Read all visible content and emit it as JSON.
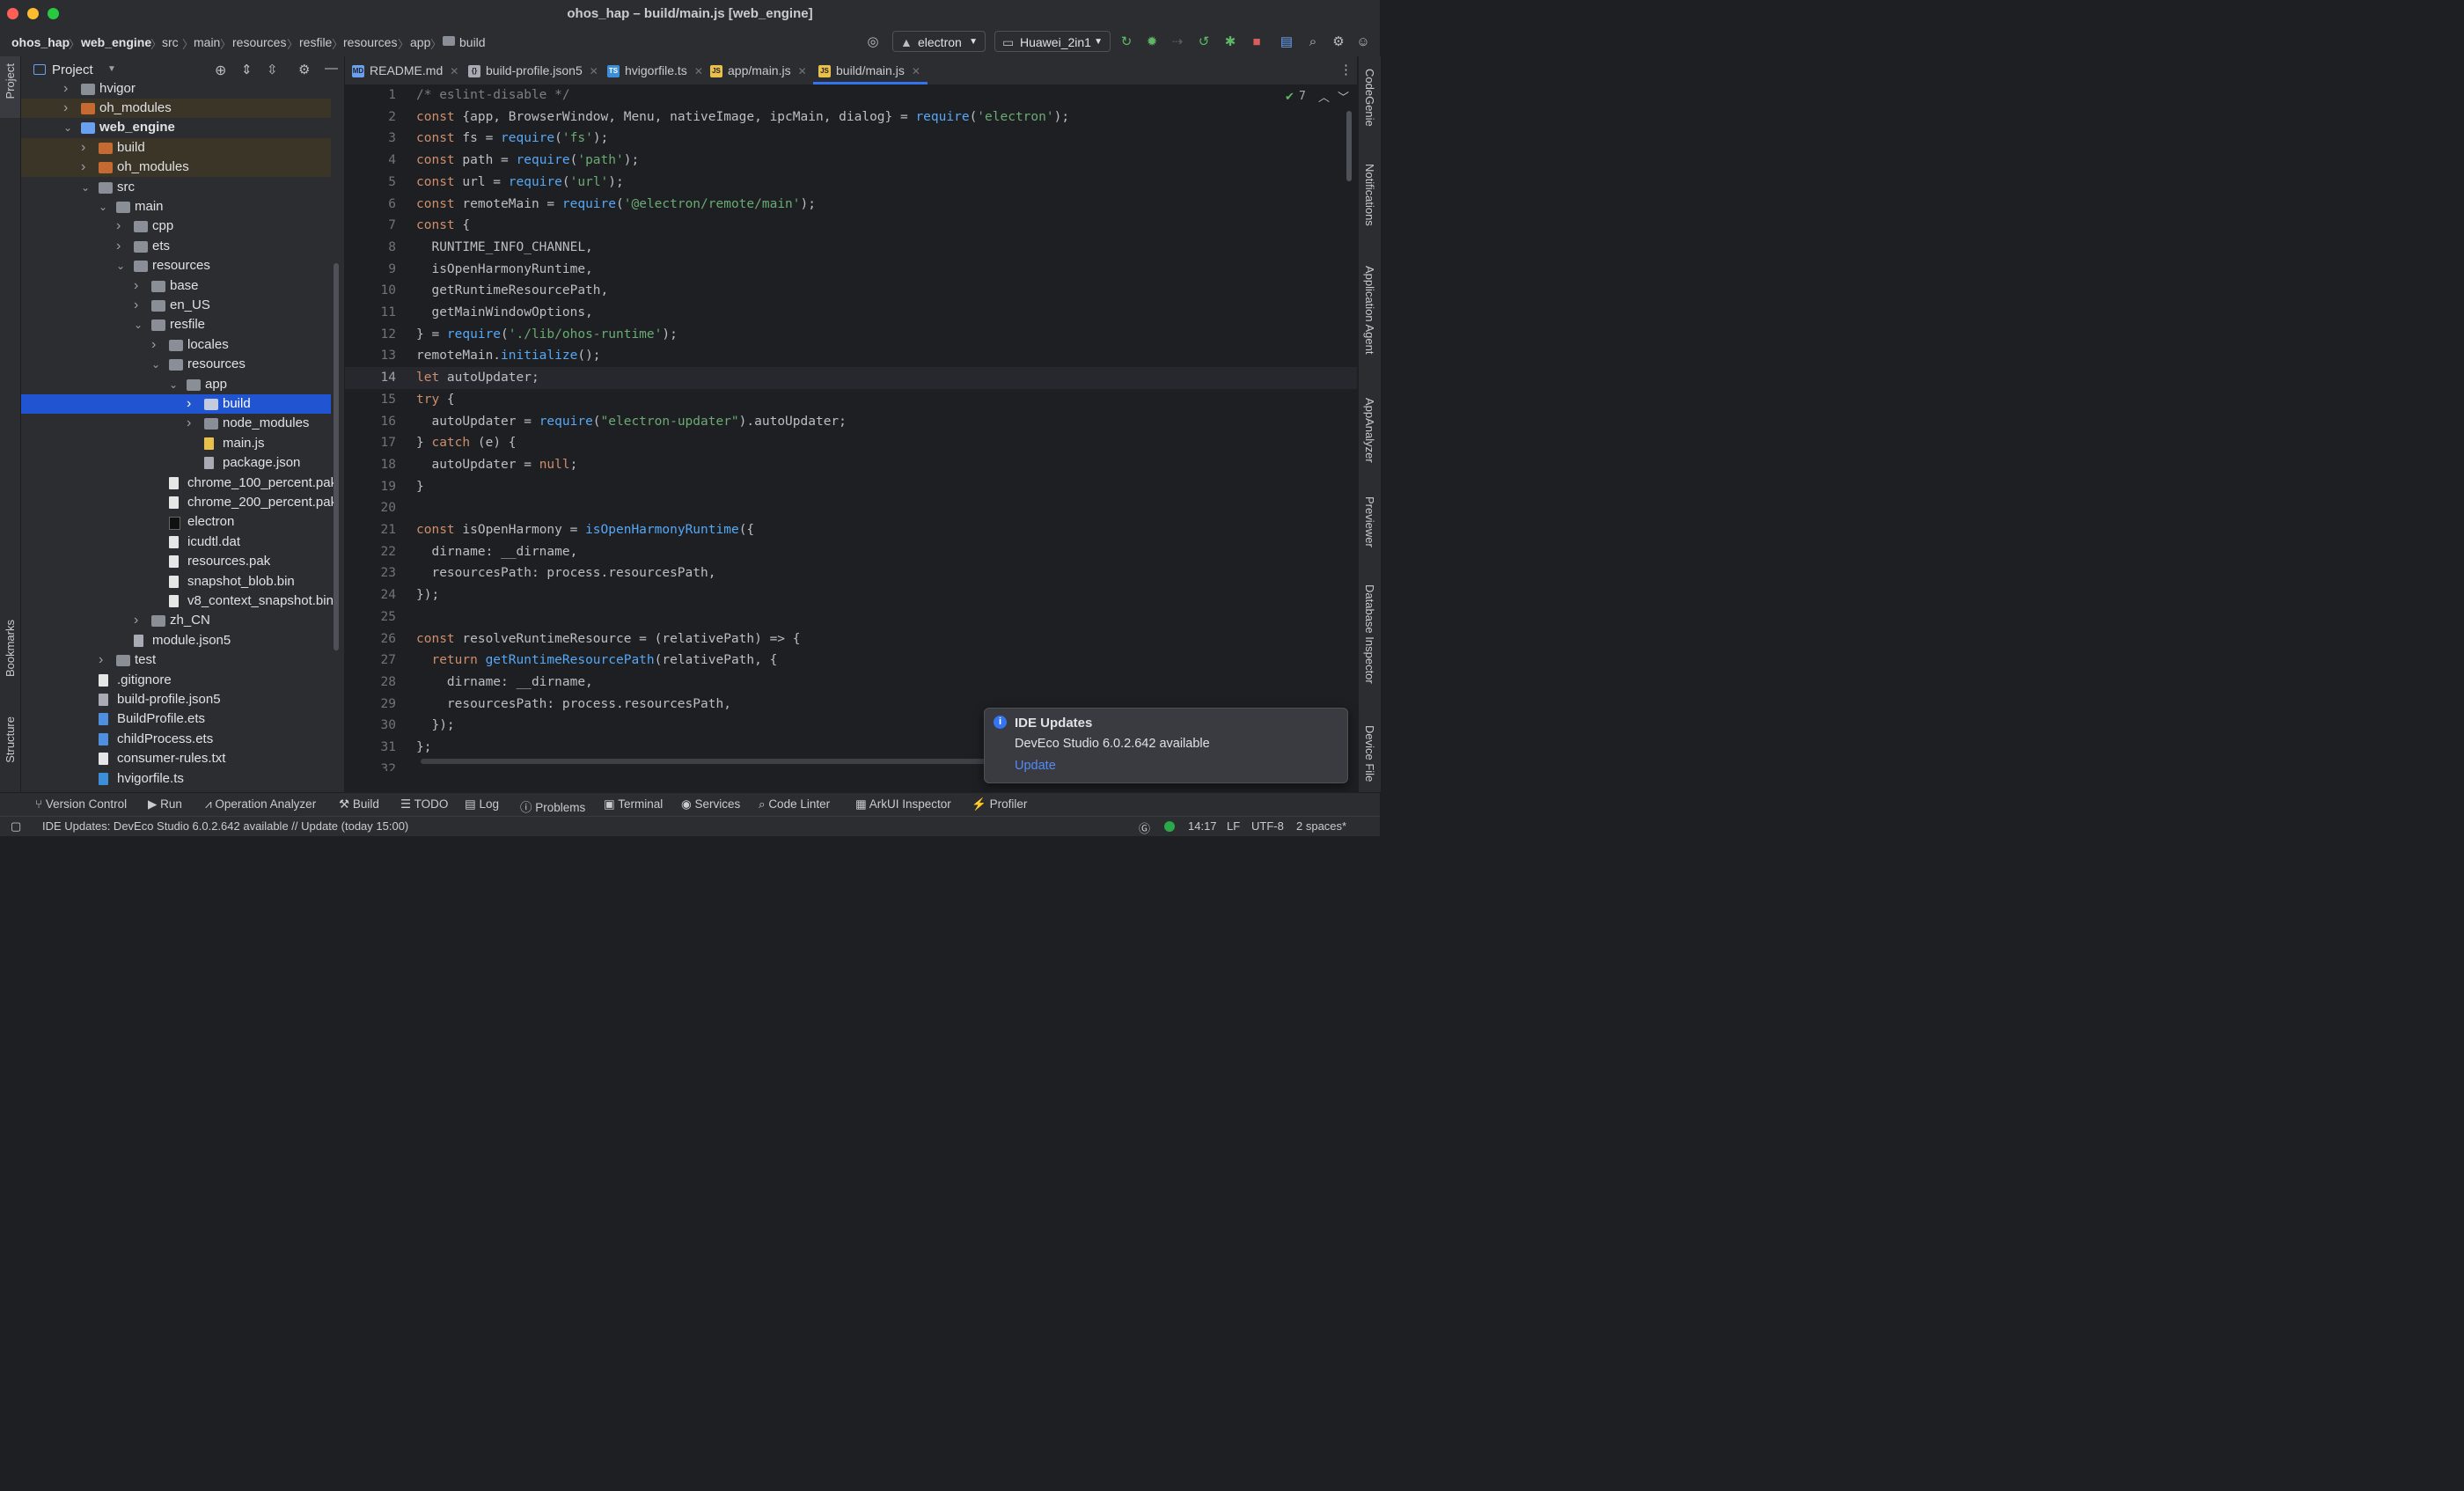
{
  "window": {
    "title": "ohos_hap – build/main.js [web_engine]"
  },
  "breadcrumbs": [
    "ohos_hap",
    "web_engine",
    "src",
    "main",
    "resources",
    "resfile",
    "resources",
    "app",
    "build"
  ],
  "toolbar": {
    "run_config": "electron",
    "device": "Huawei_2in1"
  },
  "project_panel": {
    "title": "Project"
  },
  "tree": [
    {
      "label": "hvigor",
      "depth": 1,
      "kind": "folder",
      "arrow": "right"
    },
    {
      "label": "oh_modules",
      "depth": 1,
      "kind": "folder-orange",
      "arrow": "right",
      "excluded": true
    },
    {
      "label": "web_engine",
      "depth": 1,
      "kind": "folder-module",
      "arrow": "down",
      "bold": true
    },
    {
      "label": "build",
      "depth": 2,
      "kind": "folder-orange",
      "arrow": "right",
      "excluded": true
    },
    {
      "label": "oh_modules",
      "depth": 2,
      "kind": "folder-orange",
      "arrow": "right",
      "excluded": true
    },
    {
      "label": "src",
      "depth": 2,
      "kind": "folder",
      "arrow": "down"
    },
    {
      "label": "main",
      "depth": 3,
      "kind": "folder",
      "arrow": "down"
    },
    {
      "label": "cpp",
      "depth": 4,
      "kind": "folder",
      "arrow": "right"
    },
    {
      "label": "ets",
      "depth": 4,
      "kind": "folder",
      "arrow": "right"
    },
    {
      "label": "resources",
      "depth": 4,
      "kind": "folder",
      "arrow": "down"
    },
    {
      "label": "base",
      "depth": 5,
      "kind": "folder",
      "arrow": "right"
    },
    {
      "label": "en_US",
      "depth": 5,
      "kind": "folder",
      "arrow": "right"
    },
    {
      "label": "resfile",
      "depth": 5,
      "kind": "folder",
      "arrow": "down"
    },
    {
      "label": "locales",
      "depth": 6,
      "kind": "folder",
      "arrow": "right"
    },
    {
      "label": "resources",
      "depth": 6,
      "kind": "folder",
      "arrow": "down"
    },
    {
      "label": "app",
      "depth": 7,
      "kind": "folder",
      "arrow": "down"
    },
    {
      "label": "build",
      "depth": 8,
      "kind": "folder",
      "arrow": "right",
      "selected": true
    },
    {
      "label": "node_modules",
      "depth": 8,
      "kind": "folder",
      "arrow": "right"
    },
    {
      "label": "main.js",
      "depth": 8,
      "kind": "js"
    },
    {
      "label": "package.json",
      "depth": 8,
      "kind": "json"
    },
    {
      "label": "chrome_100_percent.pak",
      "depth": 6,
      "kind": "file"
    },
    {
      "label": "chrome_200_percent.pak",
      "depth": 6,
      "kind": "file"
    },
    {
      "label": "electron",
      "depth": 6,
      "kind": "exec"
    },
    {
      "label": "icudtl.dat",
      "depth": 6,
      "kind": "file"
    },
    {
      "label": "resources.pak",
      "depth": 6,
      "kind": "file"
    },
    {
      "label": "snapshot_blob.bin",
      "depth": 6,
      "kind": "file"
    },
    {
      "label": "v8_context_snapshot.bin",
      "depth": 6,
      "kind": "file"
    },
    {
      "label": "zh_CN",
      "depth": 5,
      "kind": "folder",
      "arrow": "right"
    },
    {
      "label": "module.json5",
      "depth": 4,
      "kind": "json"
    },
    {
      "label": "test",
      "depth": 3,
      "kind": "folder",
      "arrow": "right"
    },
    {
      "label": ".gitignore",
      "depth": 2,
      "kind": "file"
    },
    {
      "label": "build-profile.json5",
      "depth": 2,
      "kind": "json"
    },
    {
      "label": "BuildProfile.ets",
      "depth": 2,
      "kind": "ets"
    },
    {
      "label": "childProcess.ets",
      "depth": 2,
      "kind": "ets"
    },
    {
      "label": "consumer-rules.txt",
      "depth": 2,
      "kind": "file"
    },
    {
      "label": "hvigorfile.ts",
      "depth": 2,
      "kind": "ts"
    }
  ],
  "tabs": [
    {
      "label": "README.md",
      "icon": "MD"
    },
    {
      "label": "build-profile.json5",
      "icon": "{}"
    },
    {
      "label": "hvigorfile.ts",
      "icon": "TS"
    },
    {
      "label": "app/main.js",
      "icon": "JS"
    },
    {
      "label": "build/main.js",
      "icon": "JS",
      "active": true
    }
  ],
  "editor": {
    "inspection_count": "7",
    "current_line": 14,
    "lines": [
      [
        [
          "c",
          "/* eslint-disable */"
        ]
      ],
      [
        [
          "k",
          "const "
        ],
        [
          "p",
          "{app, BrowserWindow, Menu, nativeImage, ipcMain, dialog} = "
        ],
        [
          "f",
          "require"
        ],
        [
          "p",
          "("
        ],
        [
          "s",
          "'electron'"
        ],
        [
          "p",
          ");"
        ]
      ],
      [
        [
          "k",
          "const "
        ],
        [
          "p",
          "fs = "
        ],
        [
          "f",
          "require"
        ],
        [
          "p",
          "("
        ],
        [
          "s",
          "'fs'"
        ],
        [
          "p",
          ");"
        ]
      ],
      [
        [
          "k",
          "const "
        ],
        [
          "p",
          "path = "
        ],
        [
          "f",
          "require"
        ],
        [
          "p",
          "("
        ],
        [
          "s",
          "'path'"
        ],
        [
          "p",
          ");"
        ]
      ],
      [
        [
          "k",
          "const "
        ],
        [
          "p",
          "url = "
        ],
        [
          "f",
          "require"
        ],
        [
          "p",
          "("
        ],
        [
          "s",
          "'url'"
        ],
        [
          "p",
          ");"
        ]
      ],
      [
        [
          "k",
          "const "
        ],
        [
          "p",
          "remoteMain = "
        ],
        [
          "f",
          "require"
        ],
        [
          "p",
          "("
        ],
        [
          "s",
          "'@electron/remote/main'"
        ],
        [
          "p",
          ");"
        ]
      ],
      [
        [
          "k",
          "const "
        ],
        [
          "p",
          "{"
        ]
      ],
      [
        [
          "p",
          "  RUNTIME_INFO_CHANNEL,"
        ]
      ],
      [
        [
          "p",
          "  isOpenHarmonyRuntime,"
        ]
      ],
      [
        [
          "p",
          "  getRuntimeResourcePath,"
        ]
      ],
      [
        [
          "p",
          "  getMainWindowOptions,"
        ]
      ],
      [
        [
          "p",
          "} = "
        ],
        [
          "f",
          "require"
        ],
        [
          "p",
          "("
        ],
        [
          "s",
          "'./lib/ohos-runtime'"
        ],
        [
          "p",
          ");"
        ]
      ],
      [
        [
          "p",
          "remoteMain."
        ],
        [
          "f",
          "initialize"
        ],
        [
          "p",
          "();"
        ]
      ],
      [
        [
          "k",
          "let "
        ],
        [
          "p",
          "autoUpdater;"
        ]
      ],
      [
        [
          "k",
          "try "
        ],
        [
          "p",
          "{"
        ]
      ],
      [
        [
          "p",
          "  autoUpdater = "
        ],
        [
          "f",
          "require"
        ],
        [
          "p",
          "("
        ],
        [
          "s",
          "\"electron-updater\""
        ],
        [
          "p",
          ").autoUpdater;"
        ]
      ],
      [
        [
          "p",
          "} "
        ],
        [
          "k",
          "catch "
        ],
        [
          "p",
          "(e) {"
        ]
      ],
      [
        [
          "p",
          "  autoUpdater = "
        ],
        [
          "k",
          "null"
        ],
        [
          "p",
          ";"
        ]
      ],
      [
        [
          "p",
          "}"
        ]
      ],
      [],
      [
        [
          "k",
          "const "
        ],
        [
          "p",
          "isOpenHarmony = "
        ],
        [
          "f",
          "isOpenHarmonyRuntime"
        ],
        [
          "p",
          "({"
        ]
      ],
      [
        [
          "p",
          "  dirname: __dirname,"
        ]
      ],
      [
        [
          "p",
          "  resourcesPath: process.resourcesPath,"
        ]
      ],
      [
        [
          "p",
          "});"
        ]
      ],
      [],
      [
        [
          "k",
          "const "
        ],
        [
          "p",
          "resolveRuntimeResource = (relativePath) => {"
        ]
      ],
      [
        [
          "k",
          "  return "
        ],
        [
          "f",
          "getRuntimeResourcePath"
        ],
        [
          "p",
          "(relativePath, {"
        ]
      ],
      [
        [
          "p",
          "    dirname: __dirname,"
        ]
      ],
      [
        [
          "p",
          "    resourcesPath: process.resourcesPath,"
        ]
      ],
      [
        [
          "p",
          "  });"
        ]
      ],
      [
        [
          "p",
          "};"
        ]
      ],
      []
    ]
  },
  "right_tools": [
    "CodeGenie",
    "Notifications",
    "Application Agent",
    "AppAnalyzer",
    "Previewer",
    "Database Inspector",
    "Device File"
  ],
  "left_tools": [
    "Project",
    "Bookmarks",
    "Structure"
  ],
  "bottom_tools": [
    "Version Control",
    "Run",
    "Operation Analyzer",
    "Build",
    "TODO",
    "Log",
    "Problems",
    "Terminal",
    "Services",
    "Code Linter",
    "ArkUI Inspector",
    "Profiler"
  ],
  "notification": {
    "title": "IDE Updates",
    "body": "DevEco Studio 6.0.2.642 available",
    "action": "Update"
  },
  "status": {
    "message": "IDE Updates: DevEco Studio 6.0.2.642 available // Update (today 15:00)",
    "position": "14:17",
    "line_sep": "LF",
    "encoding": "UTF-8",
    "indent": "2 spaces*"
  },
  "colors": {
    "accent": "#3574f0",
    "selection": "#2154d0",
    "keyword": "#cf8e6d",
    "string": "#6aab73",
    "function": "#56a8f5"
  }
}
